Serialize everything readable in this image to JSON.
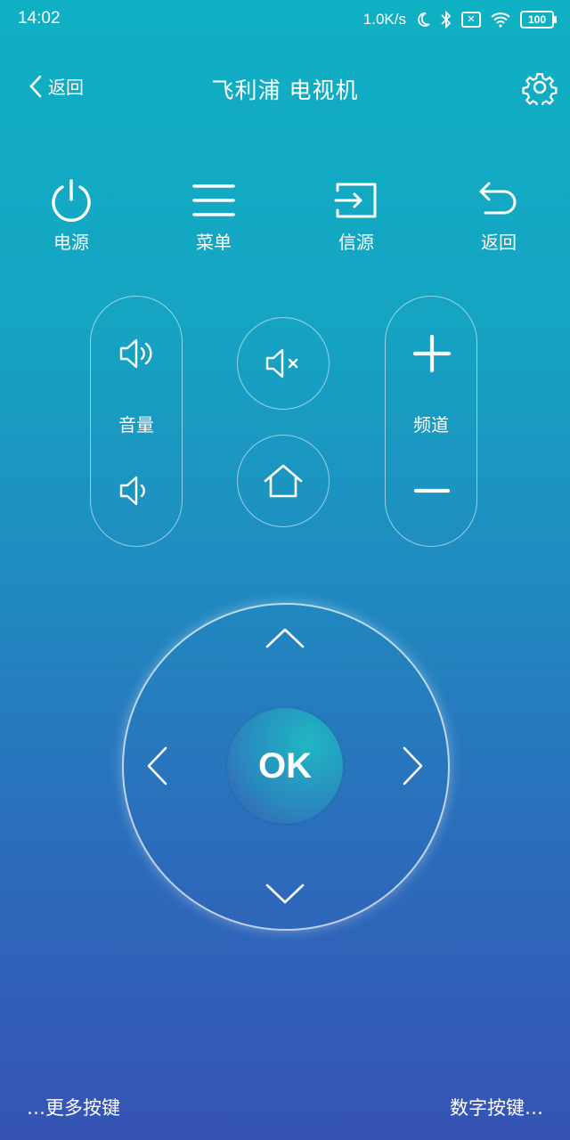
{
  "status_bar": {
    "time": "14:02",
    "net_speed": "1.0K/s",
    "battery": "100",
    "icons": [
      "moon-icon",
      "bluetooth-icon",
      "sim-x-icon",
      "wifi-icon",
      "battery-icon"
    ]
  },
  "header": {
    "back_label": "返回",
    "title": "飞利浦 电视机",
    "settings_icon": "gear-icon"
  },
  "top_row": [
    {
      "label": "电源",
      "icon": "power-icon"
    },
    {
      "label": "菜单",
      "icon": "menu-icon"
    },
    {
      "label": "信源",
      "icon": "input-source-icon"
    },
    {
      "label": "返回",
      "icon": "undo-back-icon"
    }
  ],
  "volume": {
    "label": "音量"
  },
  "channel": {
    "label": "频道"
  },
  "center": {
    "mute_icon": "mute-icon",
    "home_icon": "home-icon"
  },
  "dpad": {
    "ok_label": "OK"
  },
  "footer": {
    "more_keys": "…更多按键",
    "number_keys": "数字按键…"
  },
  "colors": {
    "gradient_top": "#0fb0c4",
    "gradient_bottom": "#3653b4",
    "foreground": "#ffffff"
  }
}
